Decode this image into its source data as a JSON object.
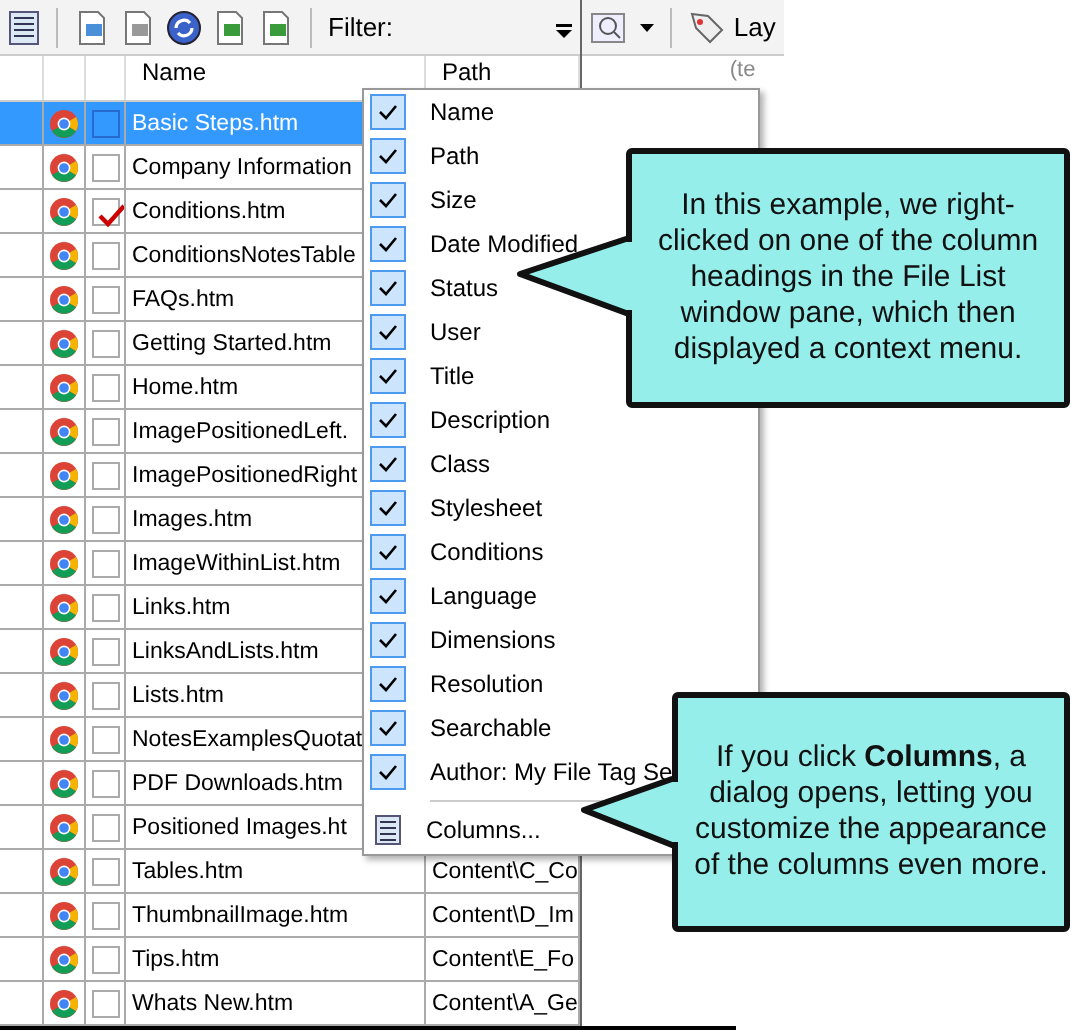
{
  "toolbar": {
    "filter_label": "Filter:"
  },
  "right_toolbar": {
    "label": "Lay",
    "hint": "(te"
  },
  "table": {
    "columns": [
      "Name",
      "Path"
    ],
    "rows": [
      {
        "name": "Basic Steps.htm",
        "selected": true,
        "checked": false
      },
      {
        "name": "Company Information",
        "selected": false,
        "checked": false
      },
      {
        "name": "Conditions.htm",
        "selected": false,
        "checked": true
      },
      {
        "name": "ConditionsNotesTable",
        "selected": false,
        "checked": false
      },
      {
        "name": "FAQs.htm",
        "selected": false,
        "checked": false
      },
      {
        "name": "Getting Started.htm",
        "selected": false,
        "checked": false
      },
      {
        "name": "Home.htm",
        "selected": false,
        "checked": false
      },
      {
        "name": "ImagePositionedLeft.",
        "selected": false,
        "checked": false
      },
      {
        "name": "ImagePositionedRight",
        "selected": false,
        "checked": false
      },
      {
        "name": "Images.htm",
        "selected": false,
        "checked": false
      },
      {
        "name": "ImageWithinList.htm",
        "selected": false,
        "checked": false
      },
      {
        "name": "Links.htm",
        "selected": false,
        "checked": false
      },
      {
        "name": "LinksAndLists.htm",
        "selected": false,
        "checked": false
      },
      {
        "name": "Lists.htm",
        "selected": false,
        "checked": false
      },
      {
        "name": "NotesExamplesQuotat",
        "selected": false,
        "checked": false
      },
      {
        "name": "PDF Downloads.htm",
        "selected": false,
        "checked": false
      },
      {
        "name": "Positioned Images.ht",
        "selected": false,
        "checked": false
      },
      {
        "name": "Tables.htm",
        "path": "Content\\C_Co",
        "selected": false,
        "checked": false
      },
      {
        "name": "ThumbnailImage.htm",
        "path": "Content\\D_Im",
        "selected": false,
        "checked": false
      },
      {
        "name": "Tips.htm",
        "path": "Content\\E_Fo",
        "selected": false,
        "checked": false
      },
      {
        "name": "Whats New.htm",
        "path": "Content\\A_Ge",
        "selected": false,
        "checked": false
      }
    ]
  },
  "context_menu": {
    "items": [
      {
        "kind": "check",
        "label": "Name",
        "checked": true
      },
      {
        "kind": "check",
        "label": "Path",
        "checked": true
      },
      {
        "kind": "check",
        "label": "Size",
        "checked": true
      },
      {
        "kind": "check",
        "label": "Date Modified",
        "checked": true
      },
      {
        "kind": "check",
        "label": "Status",
        "checked": true
      },
      {
        "kind": "check",
        "label": "User",
        "checked": true
      },
      {
        "kind": "check",
        "label": "Title",
        "checked": true
      },
      {
        "kind": "check",
        "label": "Description",
        "checked": true
      },
      {
        "kind": "check",
        "label": "Class",
        "checked": true
      },
      {
        "kind": "check",
        "label": "Stylesheet",
        "checked": true
      },
      {
        "kind": "check",
        "label": "Conditions",
        "checked": true
      },
      {
        "kind": "check",
        "label": "Language",
        "checked": true
      },
      {
        "kind": "check",
        "label": "Dimensions",
        "checked": true
      },
      {
        "kind": "check",
        "label": "Resolution",
        "checked": true
      },
      {
        "kind": "check",
        "label": "Searchable",
        "checked": true
      },
      {
        "kind": "check",
        "label": "Author: My File Tag Se",
        "checked": true
      },
      {
        "kind": "command",
        "label": "Columns..."
      }
    ]
  },
  "callouts": [
    {
      "text": "In this example, we right-clicked on one of the column headings in the File List window pane, which then displayed a context menu."
    },
    {
      "text": "If you click **Columns**, a dialog opens, letting you customize the appearance of the columns even more."
    }
  ]
}
